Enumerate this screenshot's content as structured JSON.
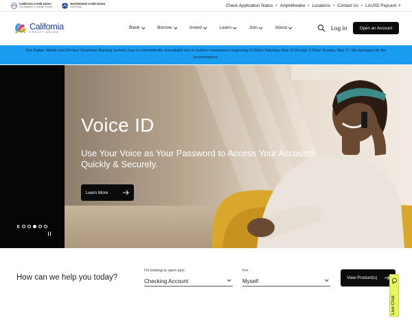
{
  "utility": {
    "brands": [
      {
        "name": "California Credit Union",
        "sub": "Los Angeles & Orange County"
      },
      {
        "name": "NorthIsland Credit Union",
        "sub": "San Diego"
      }
    ],
    "links": [
      "Check Application Status",
      "Amphitheatre",
      "Locations",
      "Contact Us",
      "LAUSD Paycard ↗"
    ]
  },
  "header": {
    "logo_name": "California",
    "logo_sub": "CREDIT UNION",
    "nav": [
      "Bank",
      "Borrow",
      "Invest",
      "Learn",
      "Join",
      "About"
    ],
    "login": "Log In",
    "open_account": "Open an Account"
  },
  "alert": {
    "text": "Our Digital, Mobile and 24-Hour Telephone Banking systems may be intermittently unavailable due to system maintenance beginning 10:30pm Saturday, May 16 through 2:30am Sunday, May 17. We apologize for the inconvenience."
  },
  "hero": {
    "title": "Voice ID",
    "subtitle": "Use Your Voice as Your Password to Access Your Accounts Quickly & Securely.",
    "cta": "Learn More",
    "slide_count": 5,
    "active_slide": 3
  },
  "finder": {
    "question": "How can we help you today?",
    "open_label": "I'm looking to open a(n):",
    "open_value": "Checking Account",
    "for_label": "For",
    "for_value": "Myself",
    "button": "View Product(s)"
  },
  "chat": {
    "label": "Live Chat"
  },
  "colors": {
    "alert_bg": "#1a9cf0",
    "brand_blue": "#1b3f94",
    "chat_bg": "#e4f564",
    "button_bg": "#0b0b0b"
  }
}
